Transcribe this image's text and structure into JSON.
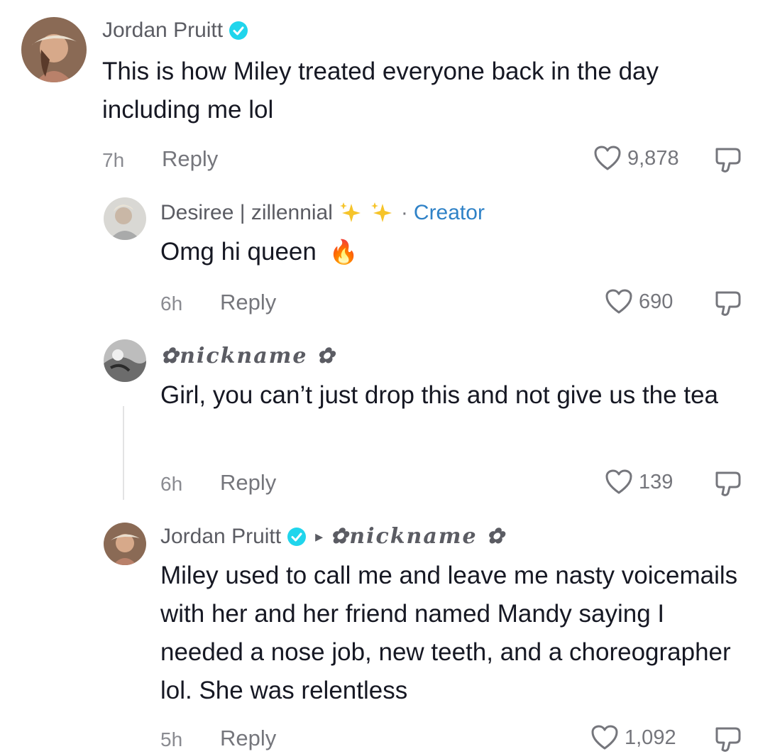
{
  "comments": [
    {
      "username": "Jordan Pruitt",
      "text": "This is how Miley treated everyone back in the day including me lol",
      "time": "7h",
      "reply": "Reply",
      "likes": "9,878",
      "verified": true
    },
    {
      "username": "Desiree | zillennial",
      "badge_separator": "·",
      "badge": "Creator",
      "text": "Omg hi queen",
      "emoji": "🔥",
      "time": "6h",
      "reply": "Reply",
      "likes": "690"
    },
    {
      "username": "✿nickname ✿",
      "text": "Girl, you can’t just drop this and not give us the tea",
      "time": "6h",
      "reply": "Reply",
      "likes": "139"
    },
    {
      "username": "Jordan Pruitt",
      "reply_arrow": "▸",
      "reply_to": "✿nickname ✿",
      "text": "Miley used to call me and leave me nasty voicemails with her and her friend named Mandy saying I needed a nose job, new teeth, and a choreographer lol. She was relentless",
      "time": "5h",
      "reply": "Reply",
      "likes": "1,092",
      "verified": true
    }
  ],
  "colors": {
    "text": "#161823",
    "secondary": "#75767c",
    "verified": "#20d5ec",
    "creator": "#2f82c7"
  },
  "icons": [
    "verified-badge-icon",
    "sparkles-icon",
    "heart-icon",
    "dislike-icon",
    "reply-arrow-icon"
  ]
}
